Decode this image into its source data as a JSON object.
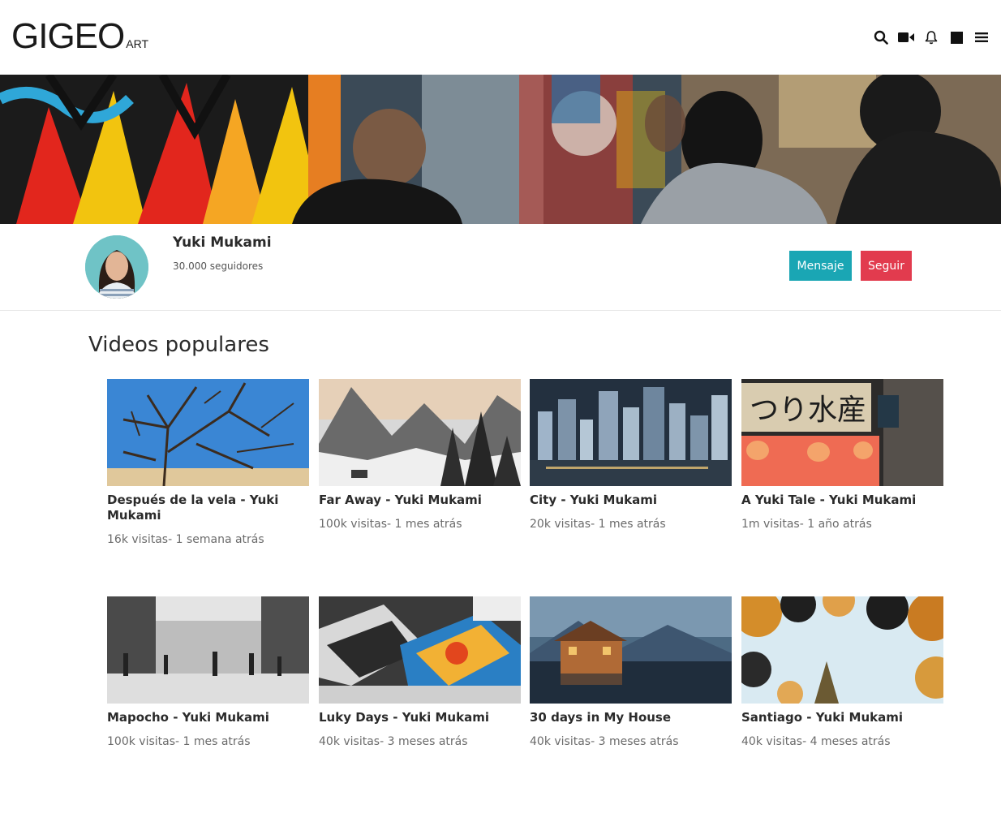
{
  "logo": {
    "main": "GIGEO",
    "sub": "ART"
  },
  "header_icons": [
    "search-icon",
    "video-camera-icon",
    "bell-icon",
    "square-icon",
    "menu-icon"
  ],
  "profile": {
    "name": "Yuki Mukami",
    "followers": "30.000 seguidores",
    "message_label": "Mensaje",
    "follow_label": "Seguir"
  },
  "section": {
    "title": "Videos populares"
  },
  "videos": [
    {
      "title": "Después de la vela - Yuki Mukami",
      "meta": "16k visitas- 1 semana atrás"
    },
    {
      "title": "Far Away - Yuki Mukami",
      "meta": "100k visitas- 1 mes atrás"
    },
    {
      "title": "City - Yuki Mukami",
      "meta": "20k visitas- 1 mes atrás"
    },
    {
      "title": "A Yuki Tale - Yuki Mukami",
      "meta": "1m visitas- 1 año atrás"
    },
    {
      "title": "Mapocho - Yuki Mukami",
      "meta": "100k visitas- 1 mes atrás"
    },
    {
      "title": "Luky Days - Yuki Mukami",
      "meta": "40k visitas- 3 meses atrás"
    },
    {
      "title": "30 days in My House",
      "meta": "40k visitas- 3 meses atrás"
    },
    {
      "title": "Santiago - Yuki Mukami",
      "meta": "40k visitas- 4 meses atrás"
    }
  ],
  "colors": {
    "message_button": "#1aa6b4",
    "follow_button": "#e23b4e",
    "avatar_bg": "#6fc3c6"
  }
}
